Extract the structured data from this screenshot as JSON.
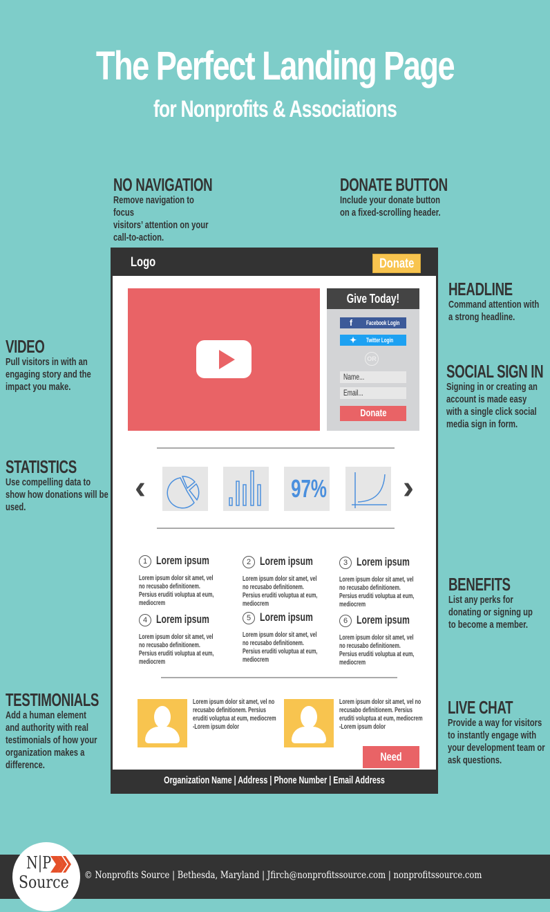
{
  "header": {
    "title": "The Perfect Landing Page",
    "subtitle": "for Nonprofits & Associations"
  },
  "annotations": {
    "no_navigation": {
      "title": "NO NAVIGATION",
      "body": "Remove navigation to focus\nvisitors’ attention on your\ncall-to-action."
    },
    "donate_button": {
      "title": "DONATE BUTTON",
      "body": "Include your donate button\non a fixed-scrolling header."
    },
    "headline": {
      "title": "HEADLINE",
      "body": "Command attention with\na strong headline."
    },
    "video": {
      "title": "VIDEO",
      "body": "Pull visitors in with an\nengaging story and the\nimpact you make."
    },
    "social_sign_in": {
      "title": "SOCIAL SIGN IN",
      "body": "Signing in or creating an\naccount is made easy\nwith a single click social\nmedia sign in form."
    },
    "statistics": {
      "title": "STATISTICS",
      "body": "Use compelling data to\nshow how donations will be\nused."
    },
    "benefits": {
      "title": "BENEFITS",
      "body": "List any perks for\ndonating or signing up\nto become a member."
    },
    "testimonials": {
      "title": "TESTIMONIALS",
      "body": "Add a human element\nand authority with real\ntestimonials of how your\norganization makes a\ndifference."
    },
    "live_chat": {
      "title": "LIVE CHAT",
      "body": "Provide a way for visitors\nto instantly engage with\nyour development team or\nask questions."
    }
  },
  "mock": {
    "logo": "Logo",
    "donate": "Donate",
    "give": {
      "title": "Give Today!",
      "facebook": "Facebook Login",
      "twitter": "Twitter Login",
      "or": "OR",
      "name_placeholder": "Name...",
      "email_placeholder": "Email...",
      "donate": "Donate"
    },
    "stats": {
      "percent": "97%",
      "icons": [
        "pie-chart-icon",
        "bar-chart-icon",
        "percent-stat",
        "growth-curve-icon"
      ]
    },
    "benefits": [
      {
        "num": "1",
        "title": "Lorem ipsum",
        "body": "Lorem ipsum dolor sit amet, vel no recusabo definitionem. Persius eruditi voluptua at eum, mediocrem"
      },
      {
        "num": "2",
        "title": "Lorem ipsum",
        "body": "Lorem ipsum dolor sit amet, vel no recusabo definitionem. Persius eruditi voluptua at eum, mediocrem"
      },
      {
        "num": "3",
        "title": "Lorem ipsum",
        "body": "Lorem ipsum dolor sit amet, vel no recusabo definitionem. Persius eruditi voluptua at eum, mediocrem"
      },
      {
        "num": "4",
        "title": "Lorem ipsum",
        "body": "Lorem ipsum dolor sit amet, vel no recusabo definitionem. Persius eruditi voluptua at eum, mediocrem"
      },
      {
        "num": "5",
        "title": "Lorem ipsum",
        "body": "Lorem ipsum dolor sit amet, vel no recusabo definitionem. Persius eruditi voluptua at eum, mediocrem"
      },
      {
        "num": "6",
        "title": "Lorem ipsum",
        "body": "Lorem ipsum dolor sit amet, vel no recusabo definitionem. Persius eruditi voluptua at eum, mediocrem"
      }
    ],
    "testimonials": [
      {
        "lines": [
          "Lorem ipsum dolor sit amet, vel no",
          "recusabo definitionem. Persius",
          "eruditi voluptua at eum, mediocrem",
          "-Lorem ipsum dolor"
        ]
      },
      {
        "lines": [
          "Lorem ipsum dolor sit amet, vel no",
          "recusabo definitionem. Persius",
          "eruditi voluptua at eum, mediocrem",
          "-Lorem ipsum dolor"
        ]
      }
    ],
    "need_help": "Need help?",
    "footer": "Organization Name | Address | Phone Number | Email Address"
  },
  "footer": {
    "logo_top": "N|P",
    "logo_bottom": "Source",
    "text": "© Nonprofits Source | Bethesda, Maryland | Jfirch@nonprofitssource.com | nonprofitssource.com"
  },
  "colors": {
    "background": "#7ecdc9",
    "dark": "#333333",
    "accent_red": "#e96366",
    "accent_yellow": "#f8c44f",
    "stat_blue": "#4a8fdd",
    "facebook": "#3c5a99",
    "twitter": "#1da1f2",
    "logo_orange": "#e5512a"
  }
}
